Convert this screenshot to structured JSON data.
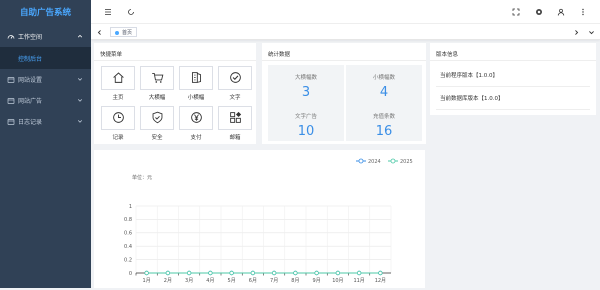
{
  "app": {
    "title": "自助广告系统"
  },
  "sidebar": {
    "items": [
      {
        "label": "工作空间",
        "icon": "dashboard-icon",
        "open": true
      },
      {
        "label": "网站设置",
        "icon": "settings-icon"
      },
      {
        "label": "网站广告",
        "icon": "ad-icon"
      },
      {
        "label": "日志记录",
        "icon": "log-icon"
      }
    ],
    "sub_items": [
      {
        "label": "控制后台"
      }
    ]
  },
  "navbar": {
    "icons": [
      "menu-fold-icon",
      "refresh-icon",
      "fullscreen-icon",
      "theme-icon",
      "user-icon",
      "more-icon"
    ]
  },
  "tags": {
    "active": "首页"
  },
  "quick": {
    "title": "快捷菜单",
    "items": [
      {
        "label": "主页",
        "icon": "home-icon"
      },
      {
        "label": "大横幅",
        "icon": "cart-icon"
      },
      {
        "label": "小横幅",
        "icon": "banner-icon"
      },
      {
        "label": "文字",
        "icon": "check-circle-icon"
      },
      {
        "label": "记录",
        "icon": "clock-icon"
      },
      {
        "label": "安全",
        "icon": "shield-check-icon"
      },
      {
        "label": "支付",
        "icon": "yen-icon"
      },
      {
        "label": "邮箱",
        "icon": "grid-icon"
      }
    ]
  },
  "stats": {
    "title": "统计数据",
    "items": [
      {
        "label": "大横幅数",
        "value": "3"
      },
      {
        "label": "小横幅数",
        "value": "4"
      },
      {
        "label": "文字广告",
        "value": "10"
      },
      {
        "label": "充值条数",
        "value": "16"
      }
    ]
  },
  "version": {
    "title": "版本信息",
    "lines": [
      "当前程序版本【1.0.0】",
      "当前数据库版本【1.0.0】"
    ]
  },
  "chart": {
    "unit_label": "单位：元"
  },
  "chart_data": {
    "type": "line",
    "categories": [
      "1月",
      "2月",
      "3月",
      "4月",
      "5月",
      "6月",
      "7月",
      "8月",
      "9月",
      "10月",
      "11月",
      "12月"
    ],
    "series": [
      {
        "name": "2024",
        "color": "#3a8ee6",
        "values": [
          0,
          0,
          0,
          0,
          0,
          0,
          0,
          0,
          0,
          0,
          0,
          0
        ]
      },
      {
        "name": "2025",
        "color": "#4cc9a7",
        "values": [
          0,
          0,
          0,
          0,
          0,
          0,
          0,
          0,
          0,
          0,
          0,
          0
        ]
      }
    ],
    "ylim": [
      0,
      1
    ],
    "yticks": [
      "0",
      "0.2",
      "0.4",
      "0.6",
      "0.8",
      "1"
    ],
    "legend": "top-right",
    "grid": true
  },
  "colors": {
    "sidebar": "#304156",
    "accent": "#3a8ee6",
    "sidebar_active": "#4aa8ff"
  }
}
